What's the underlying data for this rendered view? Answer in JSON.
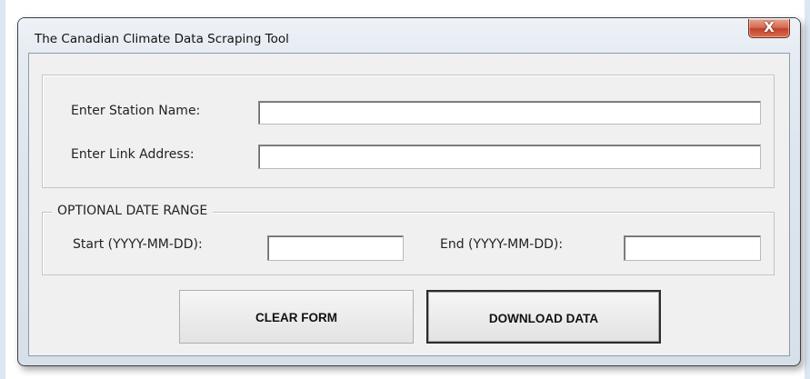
{
  "window": {
    "title": "The Canadian Climate Data Scraping Tool",
    "close_glyph": "X"
  },
  "station": {
    "label": "Enter Station Name:",
    "value": ""
  },
  "link": {
    "label": "Enter Link Address:",
    "value": ""
  },
  "date_range": {
    "legend": "OPTIONAL DATE RANGE",
    "start_label": "Start (YYYY-MM-DD):",
    "start_value": "",
    "end_label": "End (YYYY-MM-DD):",
    "end_value": ""
  },
  "buttons": {
    "clear_label": "CLEAR FORM",
    "download_label": "DOWNLOAD DATA"
  },
  "colors": {
    "close_button": "#c2412a",
    "client_background": "#f0f0f0",
    "frame_background": "#dde5ee"
  },
  "icons": {
    "close": "close-icon"
  }
}
